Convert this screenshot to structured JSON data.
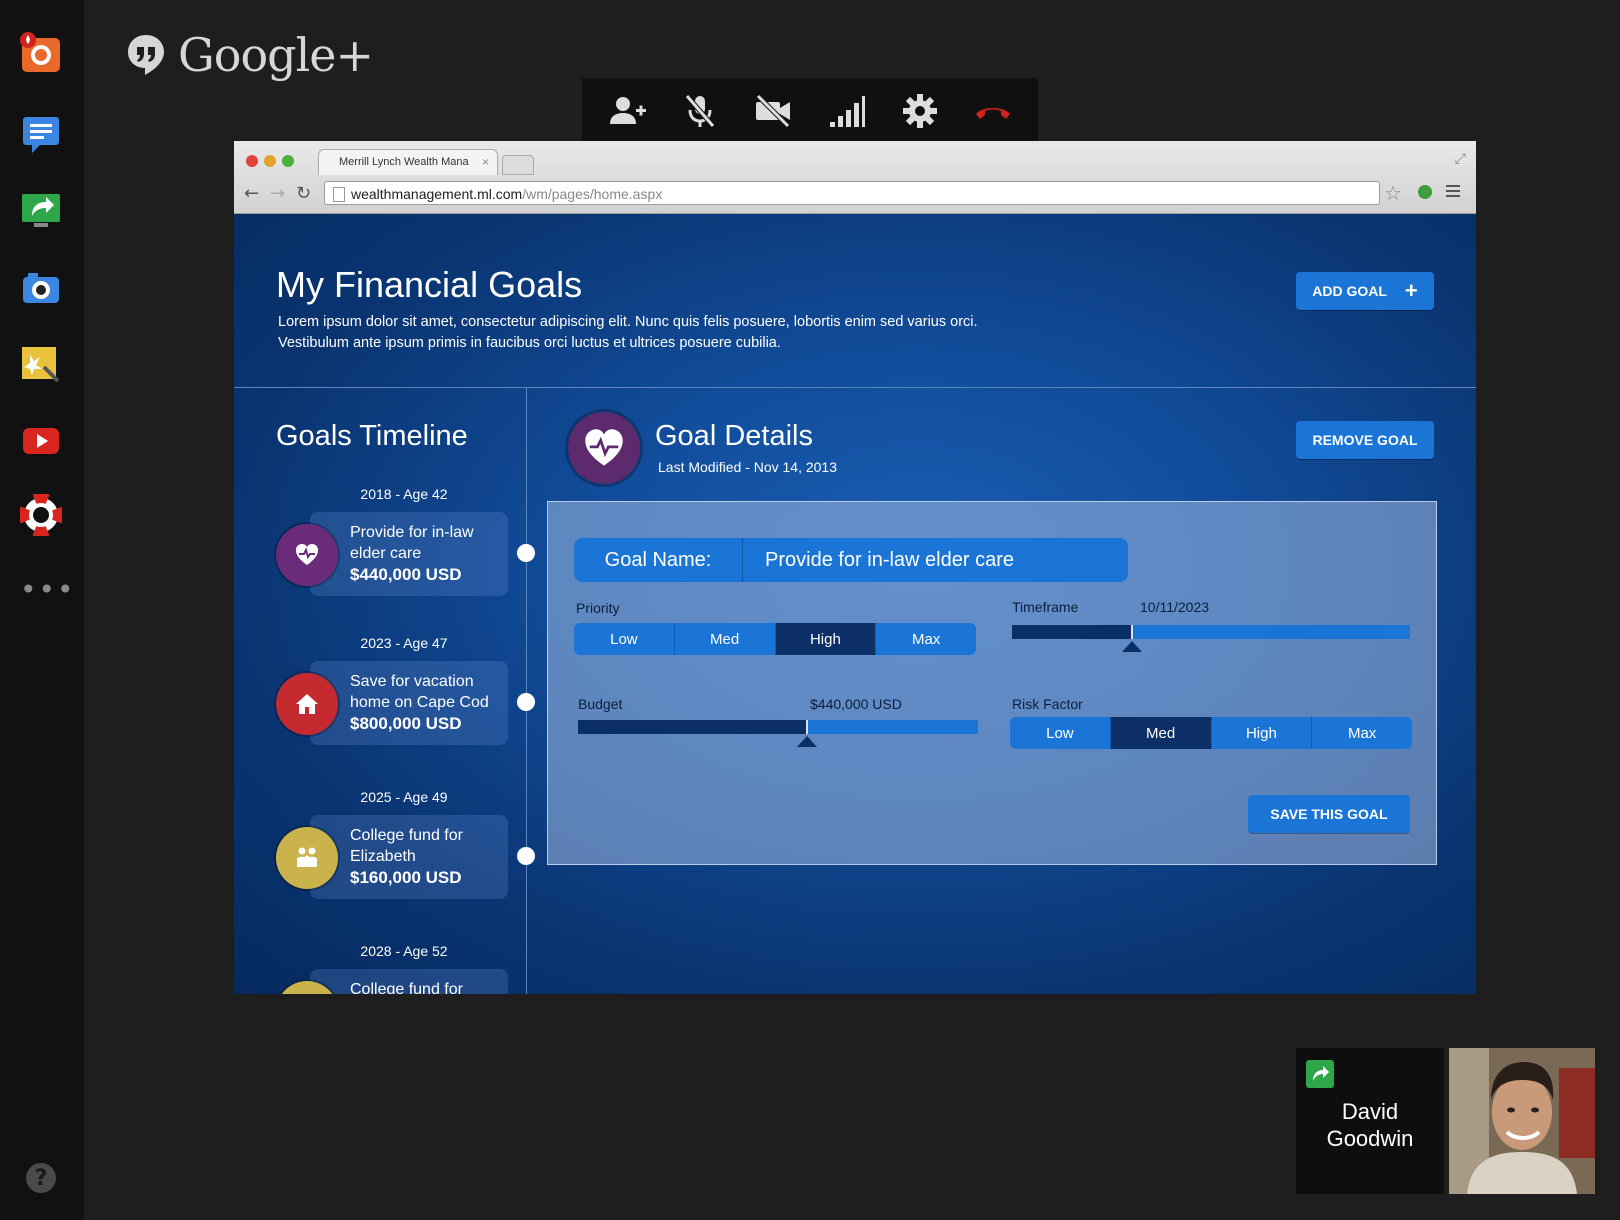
{
  "app": {
    "brand": "Google+"
  },
  "rail": {
    "items": [
      "hangout-app-icon",
      "chat-icon",
      "screenshare-icon",
      "camera-icon",
      "effects-icon",
      "youtube-icon",
      "help-ring-icon"
    ],
    "more": "•••",
    "help": "?"
  },
  "call_toolbar": {
    "buttons": [
      "invite-people",
      "mute-mic",
      "turn-off-camera",
      "bandwidth",
      "settings",
      "hang-up"
    ],
    "hangup_color": "#d0231d"
  },
  "browser": {
    "tab_title": "Merrill Lynch Wealth Mana",
    "tab_close": "×",
    "url_host": "wealthmanagement.ml.com",
    "url_path": "/wm/pages/home.aspx"
  },
  "page": {
    "title": "My Financial Goals",
    "intro_line1": "Lorem ipsum dolor sit amet, consectetur adipiscing elit. Nunc quis felis posuere, lobortis enim sed varius orci.",
    "intro_line2": "Vestibulum ante ipsum primis in faucibus orci luctus et ultrices posuere cubilia.",
    "add_goal": "ADD GOAL",
    "add_goal_icon": "+"
  },
  "timeline": {
    "title": "Goals Timeline",
    "items": [
      {
        "year": "2018 - Age 42",
        "line1": "Provide for in-law",
        "line2": "elder care",
        "amount": "$440,000 USD",
        "icon": "health-icon",
        "color": "#6a2c7a"
      },
      {
        "year": "2023 - Age 47",
        "line1": "Save for vacation",
        "line2": "home on Cape Cod",
        "amount": "$800,000 USD",
        "icon": "home-icon",
        "color": "#c42a30"
      },
      {
        "year": "2025 - Age 49",
        "line1": "College fund for",
        "line2": "Elizabeth",
        "amount": "$160,000 USD",
        "icon": "family-icon",
        "color": "#c9b34a"
      },
      {
        "year": "2028 - Age 52",
        "line1": "College fund for",
        "line2": "",
        "amount": "",
        "icon": "family-icon",
        "color": "#c9b34a"
      }
    ]
  },
  "details": {
    "title": "Goal Details",
    "last_modified": "Last Modified - Nov 14, 2013",
    "remove_goal": "REMOVE GOAL",
    "goal_name_label": "Goal Name:",
    "goal_name_value": "Provide for in-law elder care",
    "priority_label": "Priority",
    "priority_options": [
      "Low",
      "Med",
      "High",
      "Max"
    ],
    "priority_selected": "High",
    "timeframe_label": "Timeframe",
    "timeframe_value": "10/11/2023",
    "timeframe_fraction": 0.3,
    "budget_label": "Budget",
    "budget_value": "$440,000 USD",
    "budget_fraction": 0.57,
    "risk_label": "Risk Factor",
    "risk_options": [
      "Low",
      "Med",
      "High",
      "Max"
    ],
    "risk_selected": "Med",
    "save": "SAVE THIS GOAL"
  },
  "participant": {
    "first": "David",
    "last": "Goodwin"
  }
}
